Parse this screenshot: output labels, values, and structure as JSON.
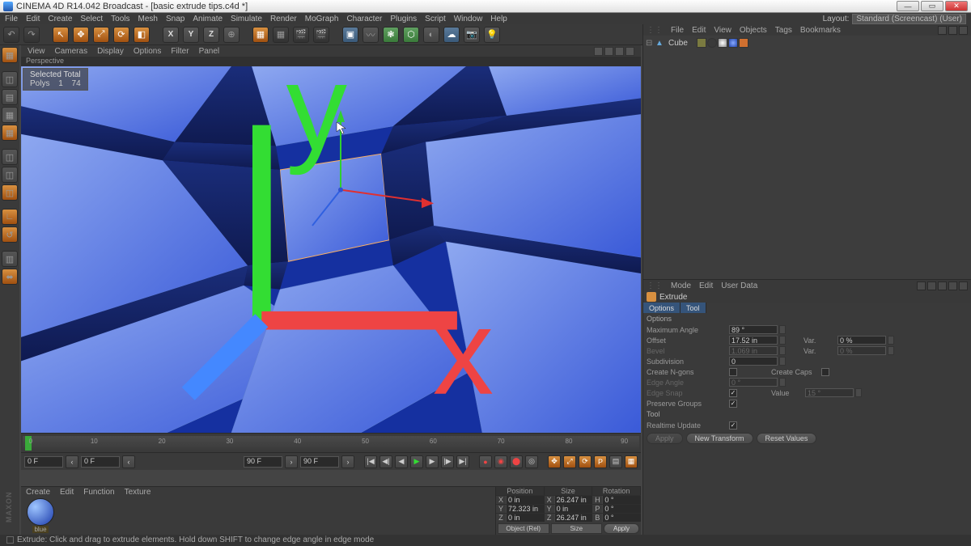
{
  "title": "CINEMA 4D R14.042 Broadcast - [basic extrude tips.c4d *]",
  "menus": [
    "File",
    "Edit",
    "Create",
    "Select",
    "Tools",
    "Mesh",
    "Snap",
    "Animate",
    "Simulate",
    "Render",
    "MoGraph",
    "Character",
    "Plugins",
    "Script",
    "Window",
    "Help"
  ],
  "layout": {
    "label": "Layout:",
    "value": "Standard (Screencast) (User)"
  },
  "vp_menu": [
    "View",
    "Cameras",
    "Display",
    "Options",
    "Filter",
    "Panel"
  ],
  "vp_label": "Perspective",
  "selected": {
    "title": "Selected Total",
    "polys_lbl": "Polys",
    "polys": "1",
    "total": "74"
  },
  "timeline": {
    "start": "0 F",
    "cur": "0 F",
    "end": "90 F",
    "endmax": "90 F",
    "ticks": [
      0,
      10,
      20,
      30,
      40,
      50,
      60,
      70,
      80,
      90
    ]
  },
  "mat_menu": [
    "Create",
    "Edit",
    "Function",
    "Texture"
  ],
  "material": {
    "name": "blue"
  },
  "coord": {
    "hdrs": [
      "Position",
      "Size",
      "Rotation"
    ],
    "rows": [
      {
        "a": "X",
        "p": "0 in",
        "s": "26.247 in",
        "r": "0 °",
        "rl": "H"
      },
      {
        "a": "Y",
        "p": "72.323 in",
        "s": "0 in",
        "r": "0 °",
        "rl": "P"
      },
      {
        "a": "Z",
        "p": "0 in",
        "s": "26.247 in",
        "r": "0 °",
        "rl": "B"
      }
    ],
    "mode": "Object (Rel)",
    "sizemode": "Size",
    "apply": "Apply"
  },
  "status": "Extrude: Click and drag to extrude elements. Hold down SHIFT to change edge angle in edge mode",
  "obj": {
    "menu": [
      "File",
      "Edit",
      "View",
      "Objects",
      "Tags",
      "Bookmarks"
    ],
    "item": "Cube"
  },
  "attr": {
    "menu": [
      "Mode",
      "Edit",
      "User Data"
    ],
    "tool": "Extrude",
    "tabs": [
      "Options",
      "Tool"
    ],
    "sect1": "Options",
    "maxangle": {
      "l": "Maximum Angle",
      "v": "89 °"
    },
    "offset": {
      "l": "Offset",
      "v": "17.52 in",
      "var_l": "Var.",
      "var_v": "0 %"
    },
    "bevel": {
      "l": "Bevel",
      "v": "1.069 in",
      "var_l": "Var.",
      "var_v": "0 %"
    },
    "subdiv": {
      "l": "Subdivision",
      "v": "0"
    },
    "ngons": {
      "l": "Create N-gons"
    },
    "caps": {
      "l": "Create Caps"
    },
    "edgeang": {
      "l": "Edge Angle",
      "v": "0 °"
    },
    "edgesnap": {
      "l": "Edge Snap"
    },
    "edgeval": {
      "l": "Value",
      "v": "15 °"
    },
    "preserve": {
      "l": "Preserve Groups"
    },
    "sect2": "Tool",
    "realtime": {
      "l": "Realtime Update"
    },
    "btns": {
      "apply": "Apply",
      "newt": "New Transform",
      "reset": "Reset Values"
    }
  },
  "maxon": "MAXON"
}
